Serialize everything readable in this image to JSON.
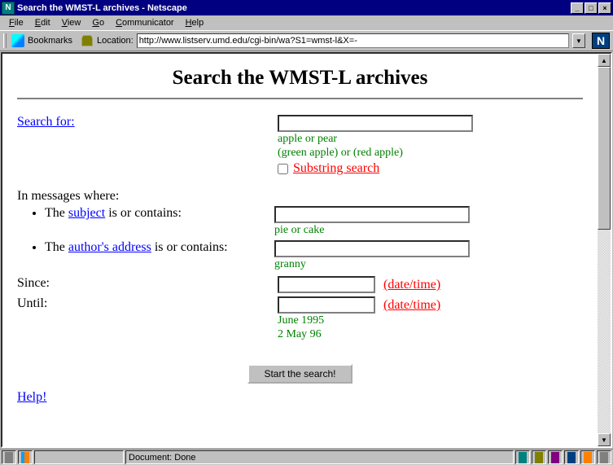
{
  "window": {
    "title": "Search the WMST-L archives - Netscape"
  },
  "menubar": {
    "items": [
      "File",
      "Edit",
      "View",
      "Go",
      "Communicator",
      "Help"
    ]
  },
  "toolbar": {
    "bookmarks_label": "Bookmarks",
    "location_label": "Location:",
    "url": "http://www.listserv.umd.edu/cgi-bin/wa?S1=wmst-l&X=-"
  },
  "page": {
    "heading": "Search the WMST-L archives",
    "search_for_label": "Search for:",
    "search_hint1": "apple or pear",
    "search_hint2": "(green apple) or (red apple)",
    "substring_label": "Substring search",
    "in_messages_label": "In messages where:",
    "subject_prefix": "The ",
    "subject_link": "subject",
    "subject_suffix": " is or contains:",
    "subject_hint": "pie or cake",
    "author_prefix": "The ",
    "author_link": "author's address",
    "author_suffix": " is or contains:",
    "author_hint": "granny",
    "since_label": "Since:",
    "until_label": "Until:",
    "datetime_link": "(date/time)",
    "date_hint1": "June 1995",
    "date_hint2": "2 May 96",
    "submit_label": "Start the search!",
    "help_label": "Help!"
  },
  "statusbar": {
    "doc": "Document: Done"
  }
}
